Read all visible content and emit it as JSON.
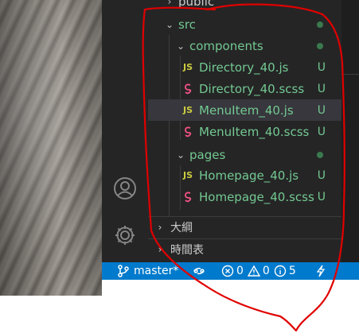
{
  "explorer": {
    "top_partial_folder": "public",
    "tree": [
      {
        "label": "src",
        "kind": "folder",
        "expanded": true,
        "status": "dot"
      },
      {
        "label": "components",
        "kind": "folder",
        "expanded": true,
        "status": "dot"
      },
      {
        "label": "Directory_40.js",
        "kind": "js",
        "status": "U"
      },
      {
        "label": "Directory_40.scss",
        "kind": "scss",
        "status": "U"
      },
      {
        "label": "MenuItem_40.js",
        "kind": "js",
        "status": "U",
        "selected": true
      },
      {
        "label": "MenuItem_40.scss",
        "kind": "scss",
        "status": "U"
      },
      {
        "label": "pages",
        "kind": "folder",
        "expanded": true,
        "status": "dot"
      },
      {
        "label": "Homepage_40.js",
        "kind": "js",
        "status": "U"
      },
      {
        "label": "Homepage_40.scss",
        "kind": "scss",
        "status": "U"
      }
    ],
    "js_icon_text": "JS",
    "status_u": "U",
    "sections": {
      "outline": "大綱",
      "timeline": "時間表"
    }
  },
  "statusbar": {
    "branch": "master*",
    "errors": "0",
    "warnings": "0",
    "info": "5"
  },
  "colors": {
    "statusbar_bg": "#007acc",
    "sidebar_bg": "#252526",
    "untracked_green": "#73c991",
    "annotation_red": "#e00000"
  }
}
